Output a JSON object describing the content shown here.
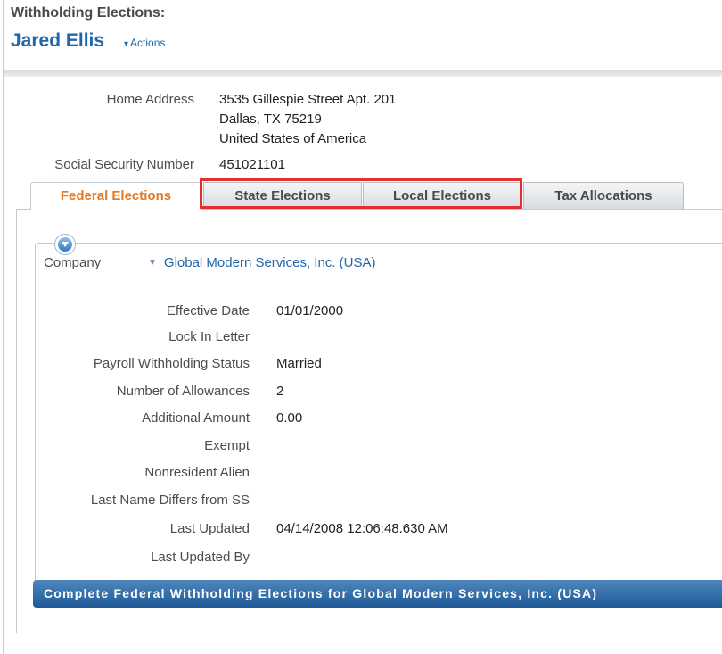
{
  "header": {
    "title": "Withholding Elections:",
    "worker_name": "Jared Ellis",
    "actions_label": "Actions"
  },
  "worker": {
    "home_address_label": "Home Address",
    "address_line1": "3535 Gillespie Street  Apt. 201",
    "address_line2": "Dallas, TX 75219",
    "address_line3": "United States of America",
    "ssn_label": "Social Security Number",
    "ssn_value": "451021101"
  },
  "tabs": [
    {
      "label": "Federal Elections",
      "active": true
    },
    {
      "label": "State Elections",
      "active": false
    },
    {
      "label": "Local Elections",
      "active": false
    },
    {
      "label": "Tax Allocations",
      "active": false
    }
  ],
  "federal": {
    "company_label": "Company",
    "company_value": "Global Modern Services, Inc. (USA)",
    "fields": [
      {
        "label": "Effective Date",
        "value": "01/01/2000"
      },
      {
        "label": "Lock In Letter",
        "value": ""
      },
      {
        "label": "Payroll Withholding Status",
        "value": "Married"
      },
      {
        "label": "Number of Allowances",
        "value": "2"
      },
      {
        "label": "Additional Amount",
        "value": "0.00"
      },
      {
        "label": "Exempt",
        "value": ""
      },
      {
        "label": "Nonresident Alien",
        "value": ""
      },
      {
        "label": "Last Name Differs from SS",
        "value": ""
      },
      {
        "label": "Last Updated",
        "value": "04/14/2008 12:06:48.630 AM"
      },
      {
        "label": "Last Updated By",
        "value": ""
      }
    ],
    "complete_button": "Complete Federal Withholding Elections for Global Modern Services, Inc. (USA)"
  },
  "colors": {
    "link_blue": "#1f67a8",
    "active_tab_orange": "#e8781f",
    "highlight_red": "#e62e2e",
    "button_blue": "#2f6aa6"
  }
}
